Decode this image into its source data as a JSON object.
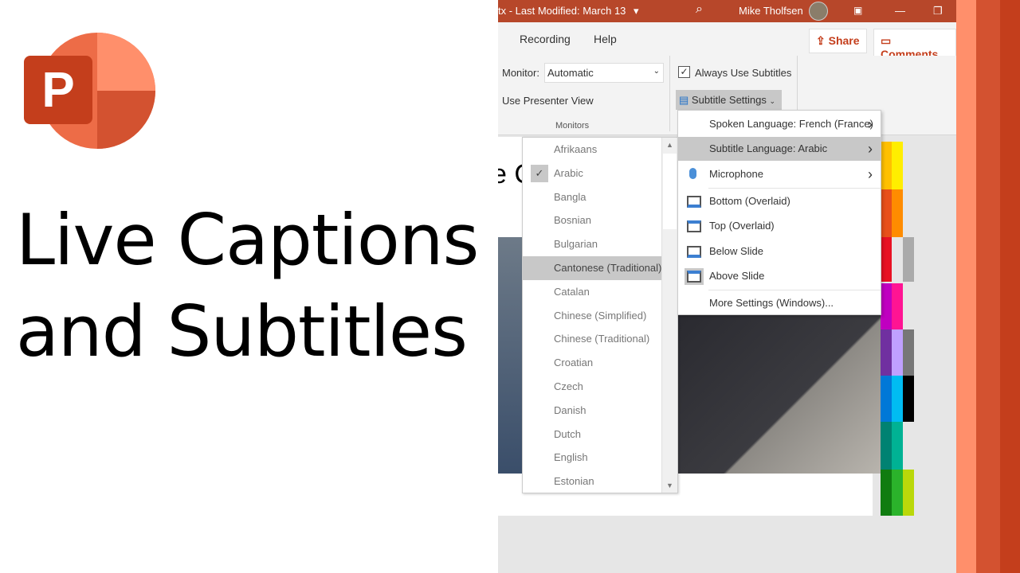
{
  "headline": {
    "line1": "Live Captions",
    "line2": "and Subtitles"
  },
  "logo": {
    "letter": "P",
    "name": "PowerPoint"
  },
  "titlebar": {
    "file": "tx - Last Modified: March 13",
    "dropdown": "▾",
    "user": "Mike Tholfsen",
    "minimize": "—",
    "restore": "❐"
  },
  "tabs": [
    {
      "label": "Recording"
    },
    {
      "label": "Help"
    }
  ],
  "share": {
    "label": "Share"
  },
  "comments": {
    "label": "Comments"
  },
  "ribbon": {
    "monitor_label": "Monitor:",
    "monitor_value": "Automatic",
    "presenter_view": "Use Presenter View",
    "group_monitors": "Monitors",
    "always_subtitles": "Always Use Subtitles",
    "always_subtitles_checked": true,
    "subtitle_settings": "Subtitle Settings"
  },
  "slide": {
    "partial_title": "e C"
  },
  "languages": {
    "selected": "Arabic",
    "hovered": "Cantonese (Traditional)",
    "items": [
      "Afrikaans",
      "Arabic",
      "Bangla",
      "Bosnian",
      "Bulgarian",
      "Cantonese (Traditional)",
      "Catalan",
      "Chinese (Simplified)",
      "Chinese (Traditional)",
      "Croatian",
      "Czech",
      "Danish",
      "Dutch",
      "English",
      "Estonian"
    ]
  },
  "menu": {
    "items": [
      {
        "label": "Spoken Language: French (France)",
        "submenu": true
      },
      {
        "label": "Subtitle Language: Arabic",
        "submenu": true,
        "active": true
      },
      {
        "label": "Microphone",
        "submenu": true,
        "icon": "microphone-icon"
      },
      {
        "label": "Bottom (Overlaid)",
        "icon": "subtitle-bottom-icon"
      },
      {
        "label": "Top (Overlaid)",
        "icon": "subtitle-top-icon"
      },
      {
        "label": "Below Slide",
        "icon": "subtitle-below-icon"
      },
      {
        "label": "Above Slide",
        "icon": "subtitle-above-icon",
        "checked": true
      },
      {
        "label": "More Settings (Windows)..."
      }
    ]
  },
  "colors": {
    "accent": "#b7472a",
    "strip1": "#ff8f6b",
    "strip2": "#d35230",
    "strip3": "#c43e1c"
  }
}
